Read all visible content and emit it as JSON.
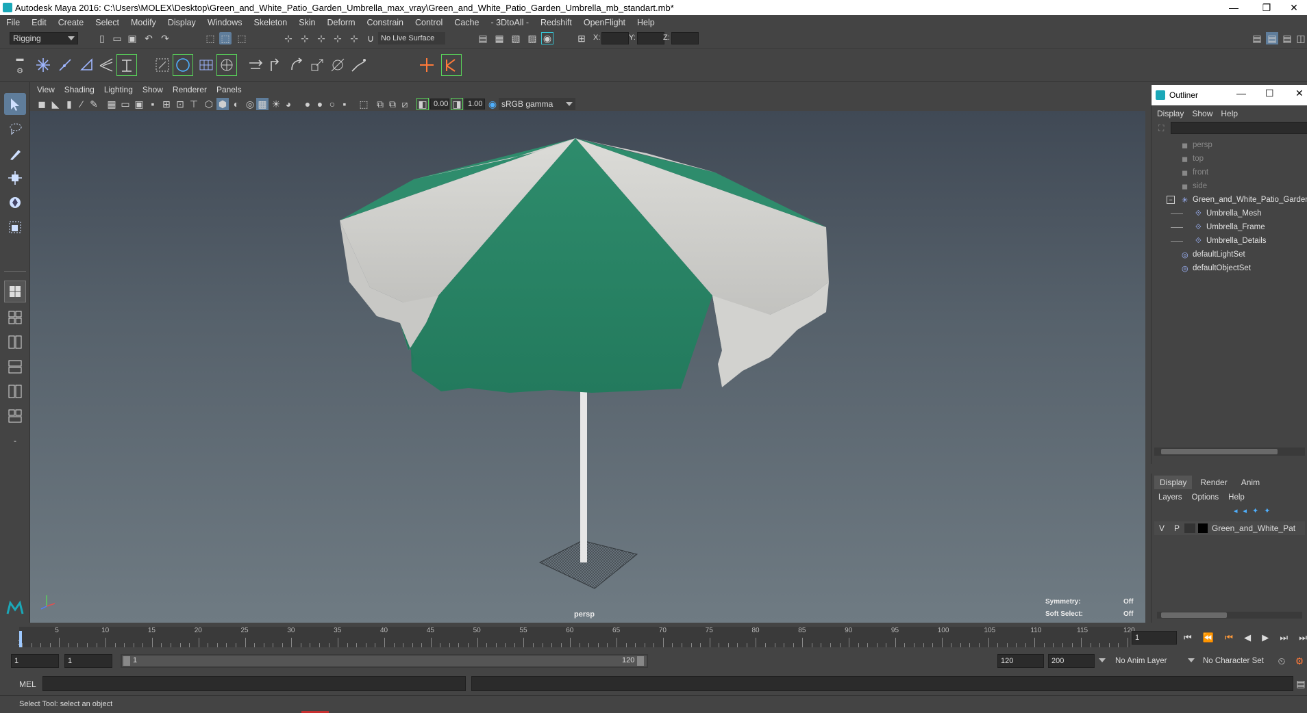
{
  "window": {
    "title": "Autodesk Maya 2016: C:\\Users\\MOLEX\\Desktop\\Green_and_White_Patio_Garden_Umbrella_max_vray\\Green_and_White_Patio_Garden_Umbrella_mb_standart.mb*",
    "minimize": "—",
    "restore": "❐",
    "close": "✕"
  },
  "main_menu": [
    "File",
    "Edit",
    "Create",
    "Select",
    "Modify",
    "Display",
    "Windows",
    "Skeleton",
    "Skin",
    "Deform",
    "Constrain",
    "Control",
    "Cache",
    "- 3DtoAll -",
    "Redshift",
    "OpenFlight",
    "Help"
  ],
  "status_line": {
    "menu_set": "Rigging",
    "live_surface": "No Live Surface",
    "x_label": "X:",
    "y_label": "Y:",
    "z_label": "Z:"
  },
  "panel_menu": [
    "View",
    "Shading",
    "Lighting",
    "Show",
    "Renderer",
    "Panels"
  ],
  "panel_toolbar": {
    "exposure": "0.00",
    "gamma": "1.00",
    "color_space": "sRGB gamma"
  },
  "viewport": {
    "camera_label": "persp",
    "symmetry_label": "Symmetry:",
    "symmetry_value": "Off",
    "soft_select_label": "Soft Select:",
    "soft_select_value": "Off",
    "colors": {
      "canopy_green": "#2f8a6a",
      "canopy_white": "#d9d9d6",
      "pole": "#e6e6e6"
    }
  },
  "outliner": {
    "title": "Outliner",
    "menu": [
      "Display",
      "Show",
      "Help"
    ],
    "items": [
      {
        "label": "persp",
        "dim": true
      },
      {
        "label": "top",
        "dim": true
      },
      {
        "label": "front",
        "dim": true
      },
      {
        "label": "side",
        "dim": true
      },
      {
        "label": "Green_and_White_Patio_Garden",
        "dim": false
      },
      {
        "label": "Umbrella_Mesh",
        "dim": false
      },
      {
        "label": "Umbrella_Frame",
        "dim": false
      },
      {
        "label": "Umbrella_Details",
        "dim": false
      },
      {
        "label": "defaultLightSet",
        "dim": false
      },
      {
        "label": "defaultObjectSet",
        "dim": false
      }
    ]
  },
  "layer_editor": {
    "tabs": [
      "Display",
      "Render",
      "Anim"
    ],
    "menu": [
      "Layers",
      "Options",
      "Help"
    ],
    "layer": {
      "v": "V",
      "p": "P",
      "name": "Green_and_White_Pat"
    }
  },
  "time_slider": {
    "ticks": [
      "5",
      "10",
      "15",
      "20",
      "25",
      "30",
      "35",
      "40",
      "45",
      "50",
      "55",
      "60",
      "65",
      "70",
      "75",
      "80",
      "85",
      "90",
      "95",
      "100",
      "105",
      "110",
      "115",
      "120"
    ],
    "start_tick": "1",
    "current_frame": "1"
  },
  "range_slider": {
    "start": "1",
    "anim_start": "1",
    "slider_start": "1",
    "slider_end": "120",
    "anim_end": "120",
    "end": "200",
    "anim_layer": "No Anim Layer",
    "character_set": "No Character Set"
  },
  "command_line": {
    "label": "MEL"
  },
  "help_line": {
    "text": "Select Tool: select an object"
  }
}
